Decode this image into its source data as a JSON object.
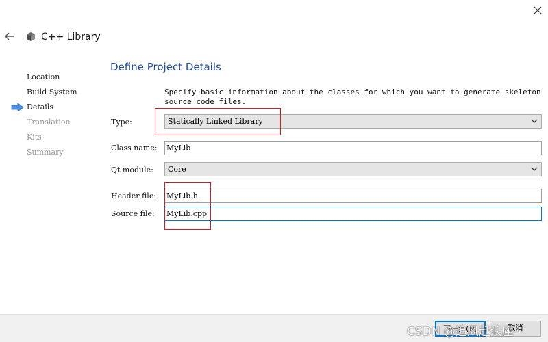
{
  "window": {
    "title": "C++ Library",
    "icons": {
      "close": "close-icon",
      "back": "back-arrow-icon",
      "wizard": "cube-icon"
    }
  },
  "steps": {
    "current_marker_icon": "arrow-right-icon",
    "items": [
      {
        "label": "Location",
        "state": "done"
      },
      {
        "label": "Build System",
        "state": "done"
      },
      {
        "label": "Details",
        "state": "current"
      },
      {
        "label": "Translation",
        "state": "future"
      },
      {
        "label": "Kits",
        "state": "future"
      },
      {
        "label": "Summary",
        "state": "future"
      }
    ]
  },
  "page": {
    "title": "Define Project Details",
    "description": "Specify basic information about the classes for which you want to generate skeleton source code files."
  },
  "form": {
    "type": {
      "label": "Type:",
      "value": "Statically Linked Library"
    },
    "class_name": {
      "label": "Class name:",
      "value": "MyLib"
    },
    "qt_module": {
      "label": "Qt module:",
      "value": "Core"
    },
    "header_file": {
      "label": "Header file:",
      "value": "MyLib.h"
    },
    "source_file": {
      "label": "Source file:",
      "value": "MyLib.cpp"
    }
  },
  "buttons": {
    "next": "下一步(N)",
    "cancel": "取消"
  },
  "watermark": "CSDN @追风赶浪座",
  "colors": {
    "title_blue": "#1f4e9c",
    "highlight_red": "#d9191f",
    "focus_blue": "#0078d7",
    "step_arrow": "#4a90e2"
  }
}
